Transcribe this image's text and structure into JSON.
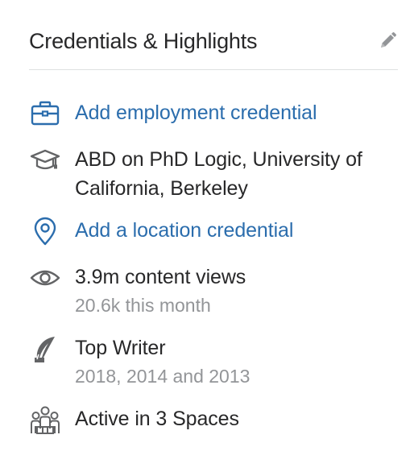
{
  "header": {
    "title": "Credentials & Highlights"
  },
  "colors": {
    "link": "#2b6dad",
    "text": "#282829",
    "muted": "#939598",
    "icon": "#636466",
    "divider": "#dee0e1"
  },
  "items": [
    {
      "icon": "briefcase-icon",
      "label": "Add employment credential"
    },
    {
      "icon": "graduation-cap-icon",
      "label": "ABD on PhD Logic, University of California, Berkeley"
    },
    {
      "icon": "location-pin-icon",
      "label": "Add a location credential"
    },
    {
      "icon": "eye-icon",
      "label": "3.9m content views",
      "sub": "20.6k this month"
    },
    {
      "icon": "quill-icon",
      "label": "Top Writer",
      "sub": "2018, 2014 and 2013"
    },
    {
      "icon": "people-icon",
      "label": "Active in 3 Spaces"
    }
  ]
}
